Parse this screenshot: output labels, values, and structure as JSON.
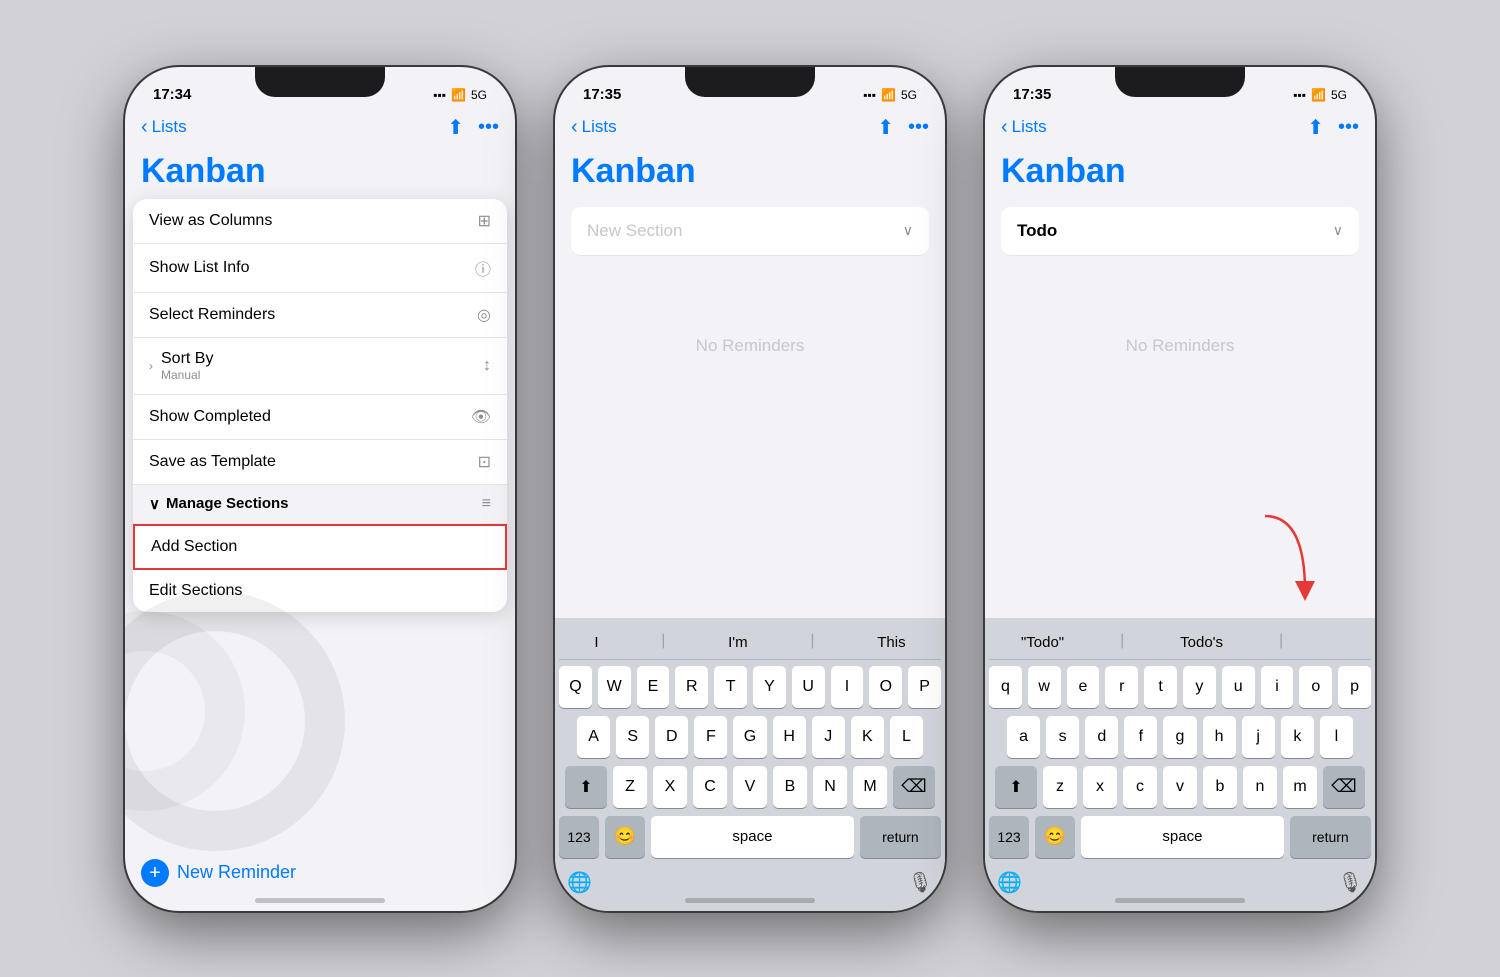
{
  "phones": [
    {
      "id": "phone1",
      "time": "17:34",
      "title": "Kanban",
      "back_label": "Lists",
      "menu_items": [
        {
          "label": "View as Columns",
          "icon": "⊞",
          "right_icon": "⊞"
        },
        {
          "label": "Show List Info",
          "icon": "ℹ",
          "right_icon": "ⓘ"
        },
        {
          "label": "Select Reminders",
          "icon": "◎",
          "right_icon": "◎"
        },
        {
          "label": "Sort By",
          "sublabel": "Manual",
          "icon": "↕",
          "right_icon": "↕",
          "has_arrow": true
        },
        {
          "label": "Show Completed",
          "icon": "👁",
          "right_icon": "👁"
        },
        {
          "label": "Save as Template",
          "icon": "⊡",
          "right_icon": "⊡"
        }
      ],
      "section_header": "Manage Sections",
      "add_section_label": "Add Section",
      "edit_sections_label": "Edit Sections",
      "new_reminder_label": "New Reminder"
    },
    {
      "id": "phone2",
      "time": "17:35",
      "title": "Kanban",
      "back_label": "Lists",
      "section_placeholder": "New Section",
      "no_reminders": "No Reminders",
      "keyboard": {
        "predictive": [
          "I",
          "I'm",
          "This"
        ],
        "rows": [
          [
            "Q",
            "W",
            "E",
            "R",
            "T",
            "Y",
            "U",
            "I",
            "O",
            "P"
          ],
          [
            "A",
            "S",
            "D",
            "F",
            "G",
            "H",
            "J",
            "K",
            "L"
          ],
          [
            "Z",
            "X",
            "C",
            "V",
            "B",
            "N",
            "M"
          ]
        ],
        "bottom": [
          "123",
          "😊",
          "space",
          "return"
        ]
      }
    },
    {
      "id": "phone3",
      "time": "17:35",
      "title": "Kanban",
      "back_label": "Lists",
      "section_name": "Todo",
      "no_reminders": "No Reminders",
      "keyboard": {
        "predictive": [
          "\"Todo\"",
          "Todo's",
          ""
        ],
        "rows": [
          [
            "q",
            "w",
            "e",
            "r",
            "t",
            "y",
            "u",
            "i",
            "o",
            "p"
          ],
          [
            "a",
            "s",
            "d",
            "f",
            "g",
            "h",
            "j",
            "k",
            "l"
          ],
          [
            "z",
            "x",
            "c",
            "v",
            "b",
            "n",
            "m"
          ]
        ],
        "bottom": [
          "123",
          "😊",
          "space",
          "return"
        ]
      }
    }
  ]
}
